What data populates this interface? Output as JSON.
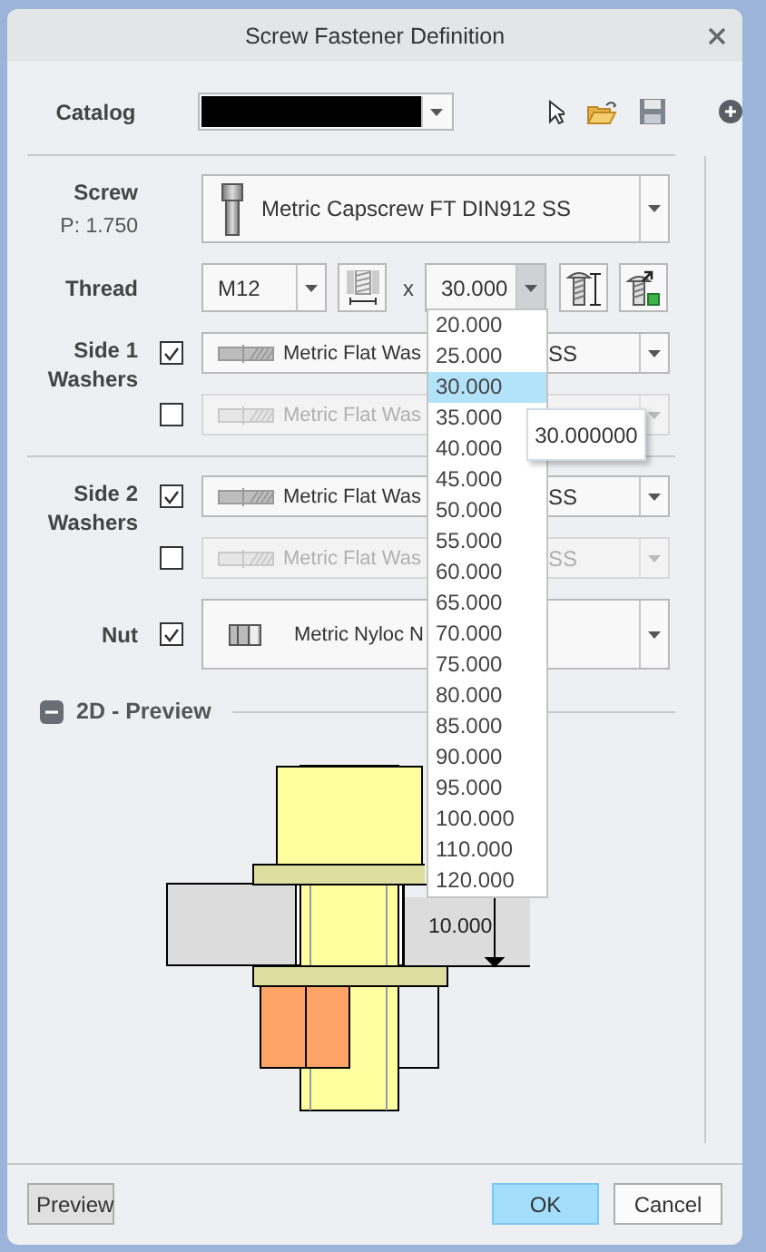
{
  "window": {
    "title": "Screw Fastener Definition"
  },
  "catalog": {
    "label": "Catalog"
  },
  "screw": {
    "label": "Screw",
    "pitch": "P: 1.750",
    "value": "Metric Capscrew FT DIN912 SS"
  },
  "thread": {
    "label": "Thread",
    "size": "M12",
    "separator": "x",
    "length": "30.000",
    "list_open": true,
    "tooltip": "30.000000",
    "options": [
      {
        "text": "20.000",
        "selected": false
      },
      {
        "text": "25.000",
        "selected": false
      },
      {
        "text": "30.000",
        "selected": true
      },
      {
        "text": "35.000",
        "selected": false
      },
      {
        "text": "40.000",
        "selected": false
      },
      {
        "text": "45.000",
        "selected": false
      },
      {
        "text": "50.000",
        "selected": false
      },
      {
        "text": "55.000",
        "selected": false
      },
      {
        "text": "60.000",
        "selected": false
      },
      {
        "text": "65.000",
        "selected": false
      },
      {
        "text": "70.000",
        "selected": false
      },
      {
        "text": "75.000",
        "selected": false
      },
      {
        "text": "80.000",
        "selected": false
      },
      {
        "text": "85.000",
        "selected": false
      },
      {
        "text": "90.000",
        "selected": false
      },
      {
        "text": "95.000",
        "selected": false
      },
      {
        "text": "100.000",
        "selected": false
      },
      {
        "text": "110.000",
        "selected": false
      },
      {
        "text": "120.000",
        "selected": false
      }
    ]
  },
  "washer_groups": [
    {
      "label": "Side 1 Washers",
      "rows": [
        {
          "checked": true,
          "value": "Metric Flat Was",
          "value_tail": "SS"
        },
        {
          "checked": false,
          "value": "Metric Flat Was"
        }
      ]
    },
    {
      "label": "Side 2 Washers",
      "rows": [
        {
          "checked": true,
          "value": "Metric Flat Was",
          "value_tail": "SS"
        },
        {
          "checked": false,
          "value": "Metric Flat Was",
          "value_tail": "SS"
        }
      ]
    }
  ],
  "nut": {
    "label": "Nut",
    "checked": true,
    "value": "Metric Nyloc N"
  },
  "preview": {
    "title": "2D - Preview",
    "expanded": true,
    "dimension": "10.000"
  },
  "buttons": [
    {
      "label": "Preview",
      "kind": "toggle"
    },
    {
      "label": "OK",
      "kind": "primary"
    },
    {
      "label": "Cancel",
      "kind": "plain"
    }
  ]
}
